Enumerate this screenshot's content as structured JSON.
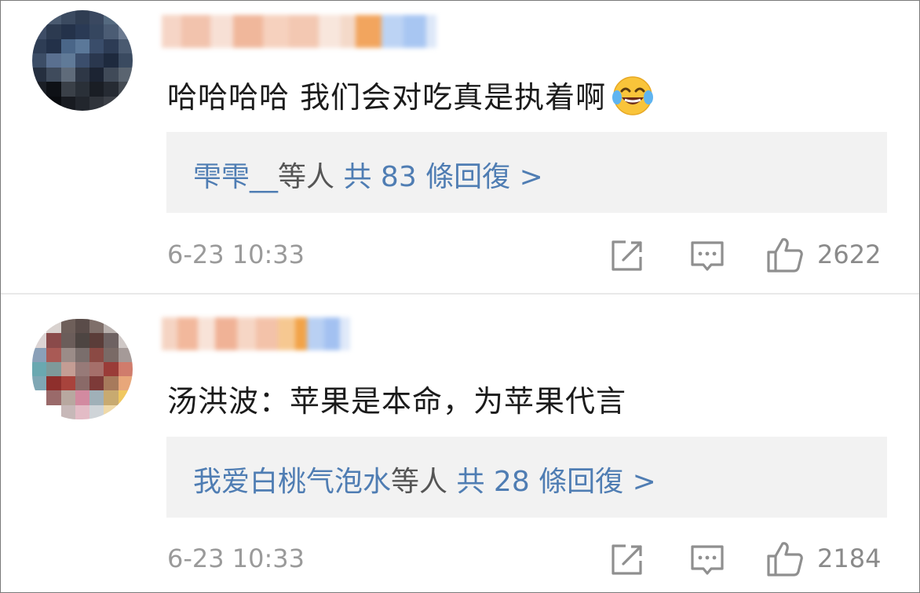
{
  "comments": [
    {
      "text": "哈哈哈哈 我们会对吃真是执着啊",
      "emoji": "face-with-tears-of-joy",
      "reply_who": "雫雫__",
      "reply_others": "等人",
      "reply_count": "共 83 條回復 >",
      "time": "6-23 10:33",
      "likes": "2622"
    },
    {
      "text": "汤洪波：苹果是本命，为苹果代言",
      "emoji": "",
      "reply_who": "我爱白桃气泡水",
      "reply_others": "等人",
      "reply_count": "共 28 條回復 >",
      "time": "6-23 10:33",
      "likes": "2184"
    }
  ],
  "colors": {
    "link": "#4f7db3",
    "meta": "#9a9a9a",
    "reply_bg": "#f2f2f2"
  },
  "icons": [
    "share-icon",
    "comment-icon",
    "like-icon",
    "laughing-emoji"
  ]
}
